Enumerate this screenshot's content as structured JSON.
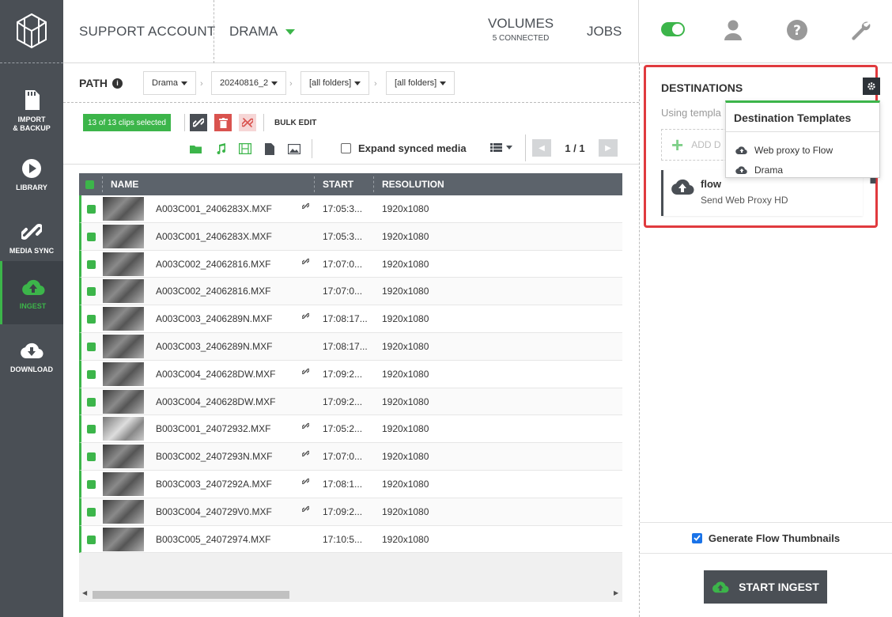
{
  "header": {
    "account": "SUPPORT ACCOUNT",
    "project": "DRAMA",
    "volumes_title": "VOLUMES",
    "volumes_sub": "5 CONNECTED",
    "jobs": "JOBS",
    "accent": "#3cb54a"
  },
  "nav": {
    "items": [
      {
        "label_line1": "IMPORT",
        "label_line2": "& BACKUP",
        "icon": "sd-card-icon"
      },
      {
        "label_line1": "LIBRARY",
        "label_line2": "",
        "icon": "play-icon"
      },
      {
        "label_line1": "MEDIA SYNC",
        "label_line2": "",
        "icon": "link-icon"
      },
      {
        "label_line1": "INGEST",
        "label_line2": "",
        "icon": "cloud-upload-icon"
      },
      {
        "label_line1": "DOWNLOAD",
        "label_line2": "",
        "icon": "cloud-download-icon"
      }
    ]
  },
  "path": {
    "label": "PATH",
    "crumbs": [
      "Drama",
      "20240816_2",
      "[all folders]",
      "[all folders]"
    ]
  },
  "toolbar": {
    "selected": "13 of 13 clips selected",
    "bulk_edit": "BULK EDIT",
    "expand_synced": "Expand synced media",
    "page": "1 / 1"
  },
  "table": {
    "headers": {
      "name": "NAME",
      "start": "START",
      "resolution": "RESOLUTION"
    },
    "rows": [
      {
        "name": "A003C001_2406283X.MXF",
        "linked": true,
        "start": "17:05:3...",
        "res": "1920x1080"
      },
      {
        "name": "A003C001_2406283X.MXF",
        "linked": false,
        "start": "17:05:3...",
        "res": "1920x1080"
      },
      {
        "name": "A003C002_24062816.MXF",
        "linked": true,
        "start": "17:07:0...",
        "res": "1920x1080"
      },
      {
        "name": "A003C002_24062816.MXF",
        "linked": false,
        "start": "17:07:0...",
        "res": "1920x1080"
      },
      {
        "name": "A003C003_2406289N.MXF",
        "linked": true,
        "start": "17:08:17...",
        "res": "1920x1080"
      },
      {
        "name": "A003C003_2406289N.MXF",
        "linked": false,
        "start": "17:08:17...",
        "res": "1920x1080"
      },
      {
        "name": "A003C004_240628DW.MXF",
        "linked": true,
        "start": "17:09:2...",
        "res": "1920x1080"
      },
      {
        "name": "A003C004_240628DW.MXF",
        "linked": false,
        "start": "17:09:2...",
        "res": "1920x1080"
      },
      {
        "name": "B003C001_24072932.MXF",
        "linked": true,
        "start": "17:05:2...",
        "res": "1920x1080"
      },
      {
        "name": "B003C002_2407293N.MXF",
        "linked": true,
        "start": "17:07:0...",
        "res": "1920x1080"
      },
      {
        "name": "B003C003_2407292A.MXF",
        "linked": true,
        "start": "17:08:1...",
        "res": "1920x1080"
      },
      {
        "name": "B003C004_240729V0.MXF",
        "linked": true,
        "start": "17:09:2...",
        "res": "1920x1080"
      },
      {
        "name": "B003C005_24072974.MXF",
        "linked": false,
        "start": "17:10:5...",
        "res": "1920x1080"
      }
    ]
  },
  "destinations": {
    "title": "DESTINATIONS",
    "using": "Using templa",
    "add": "ADD D",
    "card_name": "flow",
    "card_desc": "Send Web Proxy HD",
    "dropdown_title": "Destination Templates",
    "dropdown_items": [
      "Web proxy to Flow",
      "Drama"
    ]
  },
  "footer": {
    "generate_thumbs": "Generate Flow Thumbnails",
    "start_ingest": "START INGEST"
  }
}
